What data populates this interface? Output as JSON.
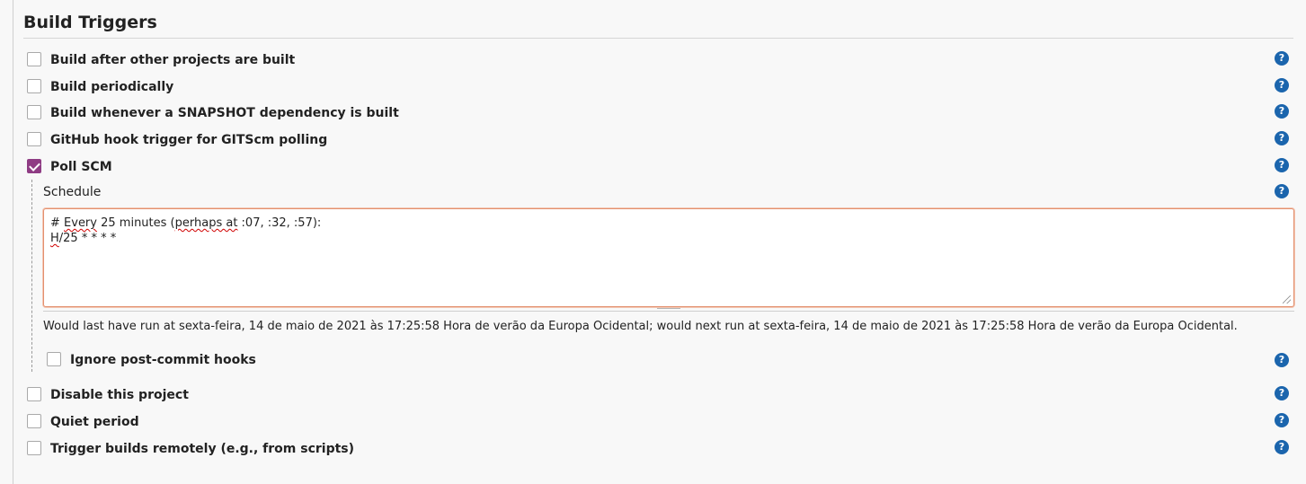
{
  "section": {
    "title": "Build Triggers"
  },
  "triggers": [
    {
      "label": "Build after other projects are built",
      "checked": false
    },
    {
      "label": "Build periodically",
      "checked": false
    },
    {
      "label": "Build whenever a SNAPSHOT dependency is built",
      "checked": false
    },
    {
      "label": "GitHub hook trigger for GITScm polling",
      "checked": false
    },
    {
      "label": "Poll SCM",
      "checked": true
    }
  ],
  "poll_scm": {
    "schedule_label": "Schedule",
    "schedule_line1_prefix": "# ",
    "schedule_line1_word1": "Every",
    "schedule_line1_mid": " 25 minutes (",
    "schedule_line1_word2": "perhaps at",
    "schedule_line1_suffix": " :07, :32, :57):",
    "schedule_line2_token": "H",
    "schedule_line2_rest": "/25 * * * *",
    "run_info": "Would last have run at sexta-feira, 14 de maio de 2021 às 17:25:58 Hora de verão da Europa Ocidental; would next run at sexta-feira, 14 de maio de 2021 às 17:25:58 Hora de verão da Europa Ocidental.",
    "ignore_hooks": {
      "label": "Ignore post-commit hooks",
      "checked": false
    }
  },
  "other_options": [
    {
      "label": "Disable this project",
      "checked": false
    },
    {
      "label": "Quiet period",
      "checked": false
    },
    {
      "label": "Trigger builds remotely (e.g., from scripts)",
      "checked": false
    }
  ],
  "help": {
    "glyph": "?"
  },
  "colors": {
    "checkbox_checked": "#8f3c84",
    "help_icon": "#1b65ad",
    "textarea_border": "#e3906f"
  }
}
